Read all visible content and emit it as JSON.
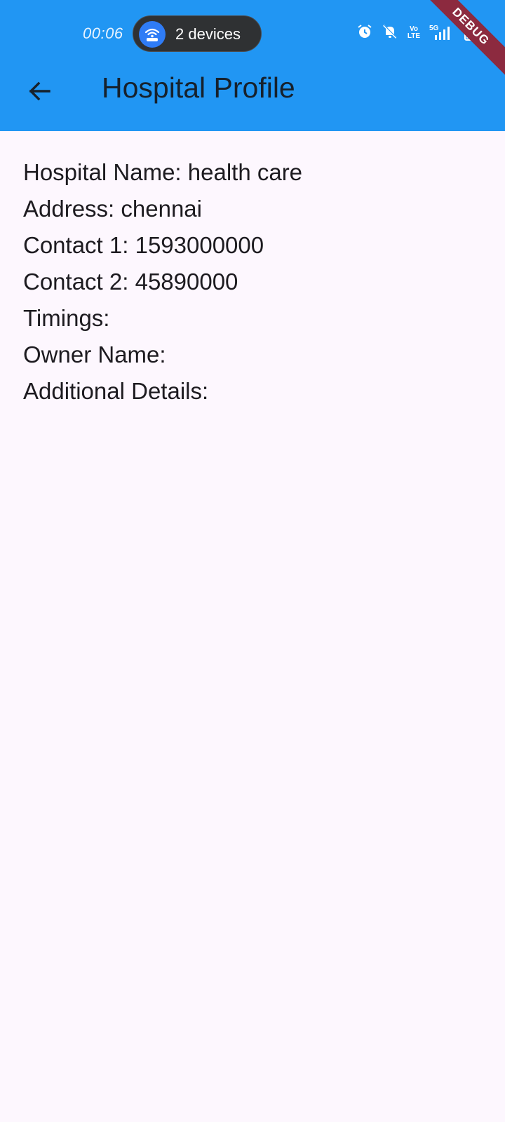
{
  "status_bar": {
    "time": "00:06",
    "hotspot_label": "2 devices",
    "five_g": "5G",
    "volte": "Vo LTE"
  },
  "app_bar": {
    "title": "Hospital Profile",
    "color": "#2196f3"
  },
  "debug_banner": "DEBUG",
  "details": [
    {
      "label": "Hospital Name: health care"
    },
    {
      "label": "Address: chennai"
    },
    {
      "label": "Contact 1: 1593000000"
    },
    {
      "label": "Contact 2: 45890000"
    },
    {
      "label": "Timings:"
    },
    {
      "label": "Owner Name:"
    },
    {
      "label": "Additional Details:"
    }
  ]
}
